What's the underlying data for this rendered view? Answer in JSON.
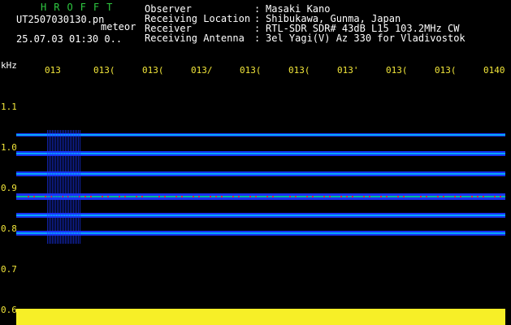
{
  "header": {
    "brand": "HROFFT",
    "filename": "UT2507030130.pn",
    "kind": "meteor",
    "datetime": "25.07.03 01:30",
    "datetime_suffix": "0..",
    "labels": [
      "Observer",
      "Receiving Location",
      "Receiver",
      "Receiving Antenna"
    ],
    "values": [
      "Masaki Kano",
      "Shibukawa, Gunma, Japan",
      "RTL-SDR SDR# 43dB L15 103.2MHz CW",
      "3el Yagi(V) Az 330 for Vladivostok"
    ],
    "colon": ":"
  },
  "axes": {
    "y_unit": "kHz",
    "y_ticks": [
      "1.1",
      "1.0",
      "0.9",
      "0.8",
      "0.7",
      "0.6"
    ],
    "x_ticks": [
      "013",
      "013(",
      "013(",
      "013/",
      "013(",
      "013(",
      "013'",
      "013(",
      "013(",
      "0140"
    ]
  },
  "colors": {
    "background": "#000000",
    "brand": "#2ec840",
    "tick": "#f2e63a",
    "band": "#f7ef27",
    "blue": "#1a35ff",
    "cyan": "#00d0ff",
    "green": "#00e676",
    "red": "#ff2a2a"
  }
}
